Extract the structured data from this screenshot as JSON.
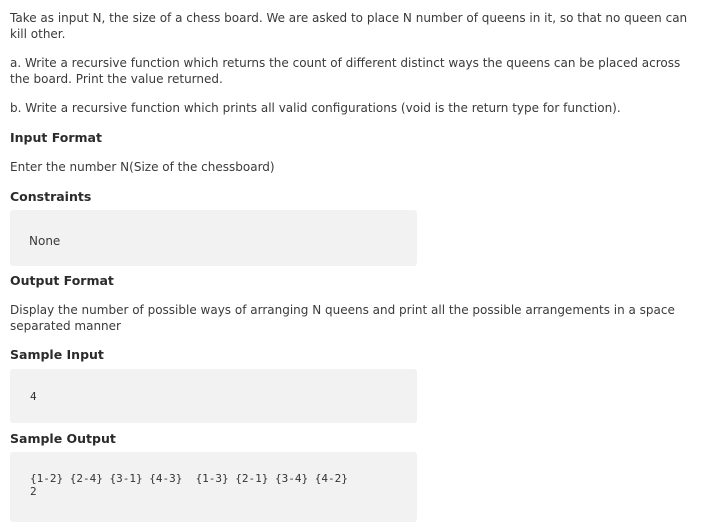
{
  "problem": {
    "intro": "Take as input N, the size of a chess board. We are asked to place N number of queens in it, so that no queen can kill other.",
    "part_a": "a. Write a recursive function which returns the count of different distinct ways the queens can be placed across the board. Print the value returned.",
    "part_b": "b. Write a recursive function which prints all valid configurations (void is the return type for function)."
  },
  "input_format": {
    "heading": "Input Format",
    "text": "Enter the number N(Size of the chessboard)"
  },
  "constraints": {
    "heading": "Constraints",
    "text": "None"
  },
  "output_format": {
    "heading": "Output Format",
    "text": "Display the number of possible ways of arranging N queens and print all the possible arrangements in a space separated manner"
  },
  "sample_input": {
    "heading": "Sample Input",
    "value": "4"
  },
  "sample_output": {
    "heading": "Sample Output",
    "line1": "{1-2} {2-4} {3-1} {4-3}  {1-3} {2-1} {3-4} {4-2}",
    "line2": "2"
  }
}
